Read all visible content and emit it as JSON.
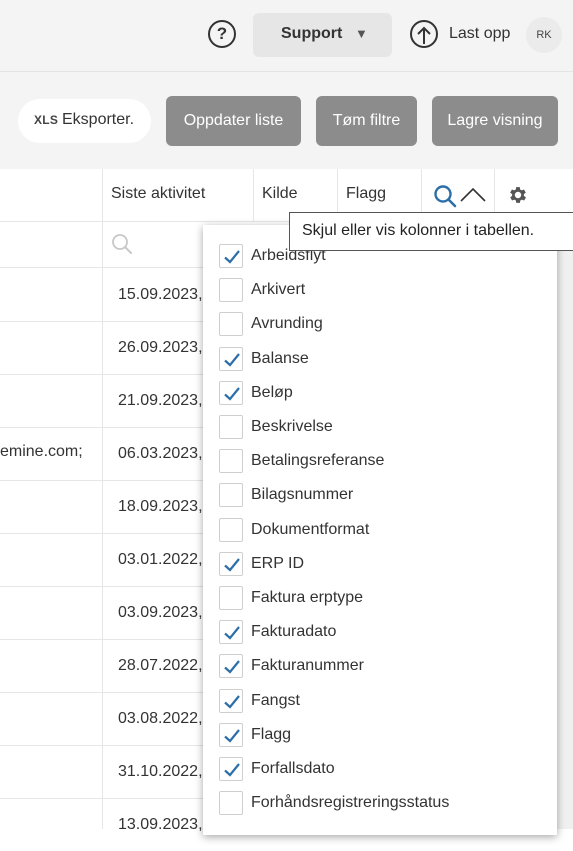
{
  "topbar": {
    "help_symbol": "?",
    "support_label": "Support",
    "support_caret": "▼",
    "upload_label": "Last opp",
    "avatar_initials": "RK"
  },
  "toolbar": {
    "xls_tag": "XLS",
    "export_label": "Eksporter.",
    "refresh_label": "Oppdater liste",
    "clear_filters_label": "Tøm filtre",
    "save_view_label": "Lagre visning"
  },
  "table": {
    "headers": {
      "last_activity": "Siste aktivitet",
      "source": "Kilde",
      "flag": "Flagg"
    },
    "rows": [
      {
        "email": "",
        "date": "15.09.2023,"
      },
      {
        "email": "",
        "date": "26.09.2023,"
      },
      {
        "email": "",
        "date": "21.09.2023,"
      },
      {
        "email": "emine.com;",
        "date": "06.03.2023,"
      },
      {
        "email": "",
        "date": "18.09.2023,"
      },
      {
        "email": "",
        "date": "03.01.2022,"
      },
      {
        "email": "",
        "date": "03.09.2023,"
      },
      {
        "email": "",
        "date": "28.07.2022,"
      },
      {
        "email": "",
        "date": "03.08.2022,"
      },
      {
        "email": "",
        "date": "31.10.2022,"
      },
      {
        "email": "",
        "date": "13.09.2023,"
      }
    ]
  },
  "tooltip": {
    "text": "Skjul eller vis kolonner i tabellen."
  },
  "column_chooser": {
    "items": [
      {
        "label": "Arbeidsflyt",
        "checked": true
      },
      {
        "label": "Arkivert",
        "checked": false
      },
      {
        "label": "Avrunding",
        "checked": false
      },
      {
        "label": "Balanse",
        "checked": true
      },
      {
        "label": "Beløp",
        "checked": true
      },
      {
        "label": "Beskrivelse",
        "checked": false
      },
      {
        "label": "Betalingsreferanse",
        "checked": false
      },
      {
        "label": "Bilagsnummer",
        "checked": false
      },
      {
        "label": "Dokumentformat",
        "checked": false
      },
      {
        "label": "ERP ID",
        "checked": true
      },
      {
        "label": "Faktura erptype",
        "checked": false
      },
      {
        "label": "Fakturadato",
        "checked": true
      },
      {
        "label": "Fakturanummer",
        "checked": true
      },
      {
        "label": "Fangst",
        "checked": true
      },
      {
        "label": "Flagg",
        "checked": true
      },
      {
        "label": "Forfallsdato",
        "checked": true
      },
      {
        "label": "Forhåndsregistreringsstatus",
        "checked": false
      }
    ]
  },
  "colors": {
    "accent": "#2c6fa8",
    "button_gray": "#8c8c8c",
    "topbar_bg": "#f4f4f4"
  }
}
